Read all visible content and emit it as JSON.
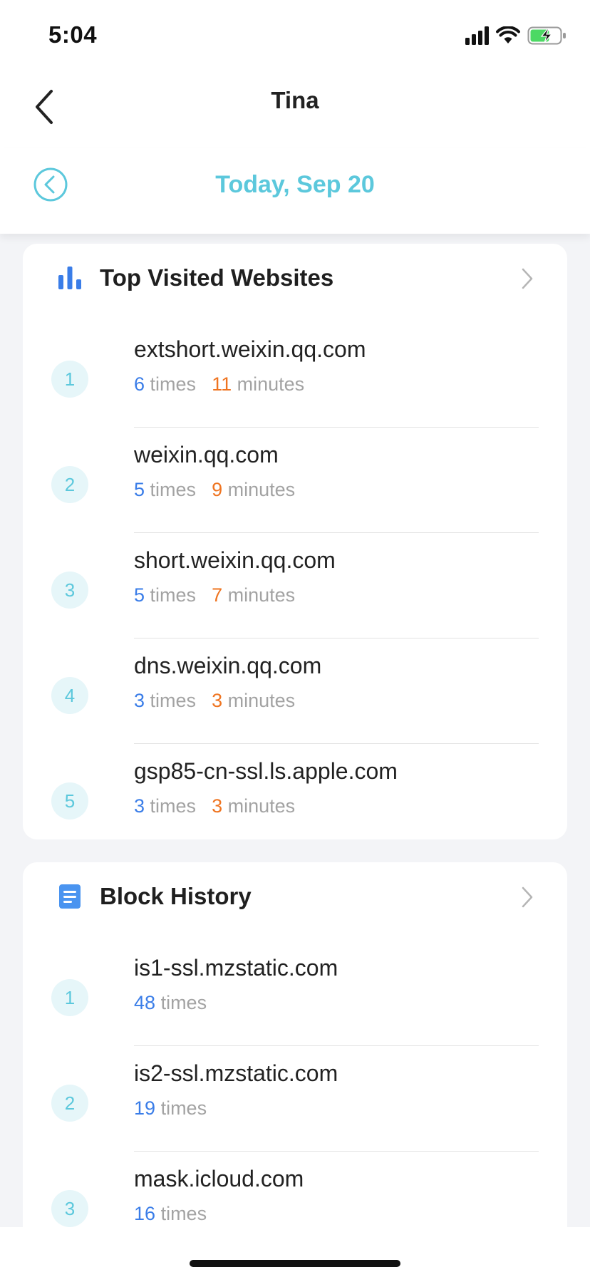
{
  "status_bar": {
    "time": "5:04"
  },
  "nav": {
    "title": "Tina"
  },
  "date_bar": {
    "label": "Today, Sep 20"
  },
  "top_websites": {
    "title": "Top Visited Websites",
    "times_unit": "times",
    "minutes_unit": "minutes",
    "items": [
      {
        "rank": "1",
        "site": "extshort.weixin.qq.com",
        "times": "6",
        "minutes": "11"
      },
      {
        "rank": "2",
        "site": "weixin.qq.com",
        "times": "5",
        "minutes": "9"
      },
      {
        "rank": "3",
        "site": "short.weixin.qq.com",
        "times": "5",
        "minutes": "7"
      },
      {
        "rank": "4",
        "site": "dns.weixin.qq.com",
        "times": "3",
        "minutes": "3"
      },
      {
        "rank": "5",
        "site": "gsp85-cn-ssl.ls.apple.com",
        "times": "3",
        "minutes": "3"
      }
    ]
  },
  "block_history": {
    "title": "Block History",
    "times_unit": "times",
    "items": [
      {
        "rank": "1",
        "site": "is1-ssl.mzstatic.com",
        "times": "48"
      },
      {
        "rank": "2",
        "site": "is2-ssl.mzstatic.com",
        "times": "19"
      },
      {
        "rank": "3",
        "site": "mask.icloud.com",
        "times": "16"
      }
    ]
  },
  "colors": {
    "accent_teal": "#5cc8dc",
    "count_blue": "#3a7de8",
    "minutes_orange": "#ef7420",
    "chart_icon_blue": "#3a7de8",
    "doc_icon_blue": "#4a94f0",
    "battery_green": "#4cd964"
  }
}
